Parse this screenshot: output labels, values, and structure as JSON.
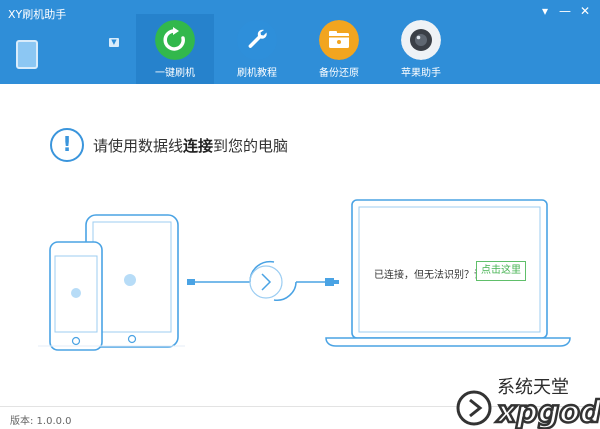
{
  "window": {
    "title": "XY刷机助手"
  },
  "controls": {
    "menu_icon": "▾",
    "minimize_icon": "—",
    "close_icon": "✕"
  },
  "tabs": [
    {
      "label": "一键刷机",
      "icon": "refresh-icon",
      "color": "#32b84c"
    },
    {
      "label": "刷机教程",
      "icon": "wrench-icon",
      "color": "#2e8fda"
    },
    {
      "label": "备份还原",
      "icon": "folder-icon",
      "color": "#f2a51f"
    },
    {
      "label": "苹果助手",
      "icon": "camera-icon",
      "color": "#eef2f6"
    }
  ],
  "notice": {
    "prefix": "请使用数据线",
    "emph": "连接",
    "suffix": "到您的电脑",
    "icon": "alert-icon"
  },
  "status": {
    "connected_text": "已连接，但无法识别？请",
    "click_here_label": "点击这里"
  },
  "footer": {
    "version": "版本: 1.0.0.0"
  },
  "watermark": {
    "text": "系统天堂",
    "subtext": "xpgod"
  }
}
